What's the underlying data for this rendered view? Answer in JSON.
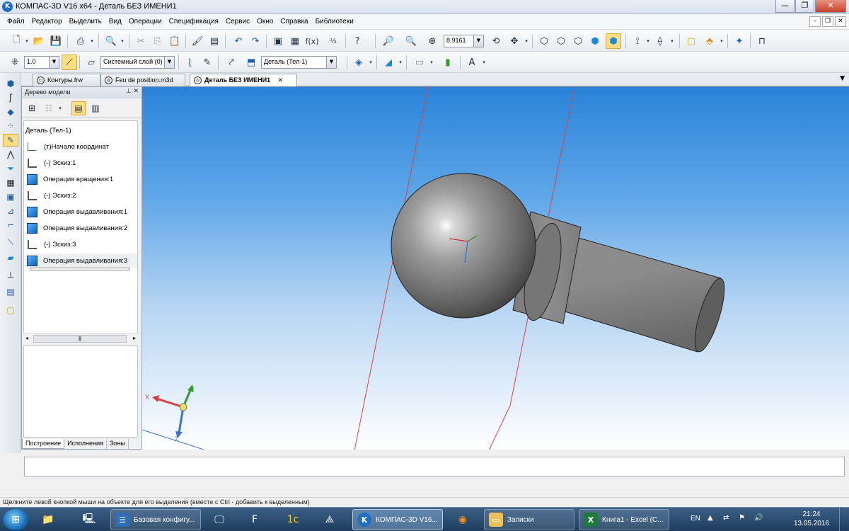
{
  "window": {
    "title": "КОМПАС-3D V16  x64 - Деталь БЕЗ ИМЕНИ1",
    "app_icon": "K",
    "controls": [
      "—",
      "❐",
      "✕"
    ]
  },
  "menu": [
    "Файл",
    "Редактор",
    "Выделить",
    "Вид",
    "Операции",
    "Спецификация",
    "Сервис",
    "Окно",
    "Справка",
    "Библиотеки"
  ],
  "toolbar1": {
    "zoom_value": "8.9161"
  },
  "toolbar2": {
    "step_value": "1.0",
    "layer_value": "Системный слой (0)",
    "part_value": "Деталь (Тел-1)"
  },
  "doc_tabs": [
    {
      "label": "Контуры.frw",
      "active": false
    },
    {
      "label": "Feu de position.m3d",
      "active": false
    },
    {
      "label": "Деталь БЕЗ ИМЕНИ1",
      "active": true
    }
  ],
  "tree_panel": {
    "title": "Дерево модели",
    "nodes": [
      {
        "label": "Деталь (Тел-1)",
        "icon": "part-icon"
      },
      {
        "label": "(т)Начало координат",
        "icon": "origin-icon"
      },
      {
        "label": "(-) Эскиз:1",
        "icon": "sketch-icon"
      },
      {
        "label": "Операция вращения:1",
        "icon": "revolve-icon"
      },
      {
        "label": "(-) Эскиз:2",
        "icon": "sketch-icon"
      },
      {
        "label": "Операция выдавливания:1",
        "icon": "extrude-icon"
      },
      {
        "label": "Операция выдавливания:2",
        "icon": "extrude-icon"
      },
      {
        "label": "(-) Эскиз:3",
        "icon": "sketch-icon"
      },
      {
        "label": "Операция выдавливания:3",
        "icon": "extrude-icon"
      }
    ],
    "tabs": [
      "Построение",
      "Исполнения",
      "Зоны"
    ],
    "active_tab": "Построение"
  },
  "axes": {
    "x": "X",
    "y": "Y",
    "z": "Z"
  },
  "status_text": "Щелкните левой кнопкой мыши на объекте для его выделения (вместе с Ctrl - добавить к выделенным)",
  "taskbar": {
    "windows": [
      {
        "label": "Базовая конфигу...",
        "icon": "1c-config-icon"
      },
      {
        "label": "КОМПАС-3D V16...",
        "icon": "kompas-icon",
        "active": true
      },
      {
        "label": "Записки",
        "icon": "folder-icon"
      },
      {
        "label": "Книга1 - Excel (С...",
        "icon": "excel-icon"
      }
    ],
    "language": "EN",
    "time": "21:24",
    "date": "13.05.2016"
  },
  "colors": {
    "accent_active": "#fcdf82",
    "viewport_top": "#2a83d9",
    "taskbar": "#1e3d5d"
  }
}
